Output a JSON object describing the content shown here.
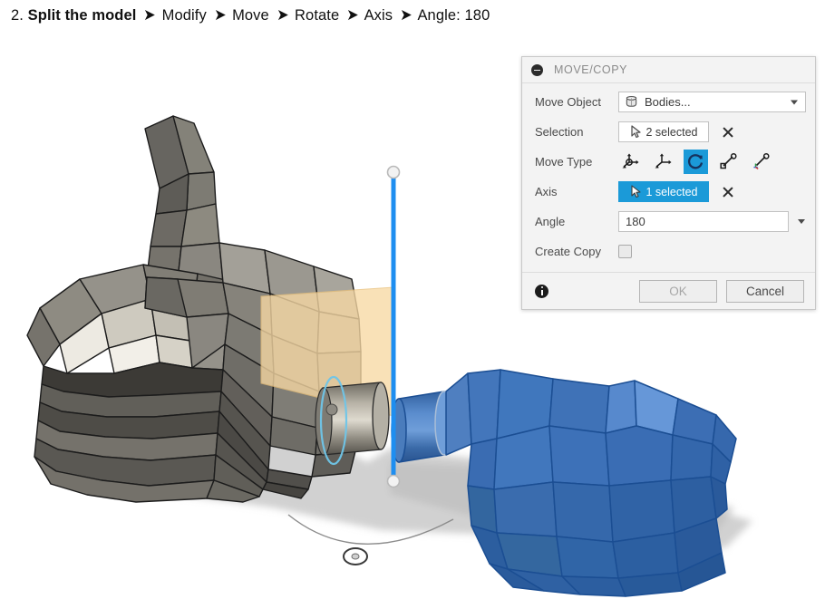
{
  "caption": {
    "step": "2.",
    "bold": "Split the model",
    "arrow_glyph": "➤",
    "items": [
      "Modify",
      "Move",
      "Rotate",
      "Axis",
      "Angle: 180"
    ]
  },
  "dialog": {
    "title": "MOVE/COPY",
    "collapse_icon": "minus-circle-icon",
    "rows": {
      "move_object": {
        "label": "Move Object",
        "value": "Bodies...",
        "icon": "body-cylinder-icon",
        "caret": "chevron-down-icon"
      },
      "selection": {
        "label": "Selection",
        "value": "2 selected",
        "icon": "cursor-arrow-icon",
        "clear": "clear-x-icon"
      },
      "move_type": {
        "label": "Move Type",
        "options": [
          {
            "name": "free-move-icon",
            "label": "Free Move",
            "active": false
          },
          {
            "name": "translate-icon",
            "label": "Translate",
            "active": false
          },
          {
            "name": "rotate-icon",
            "label": "Rotate",
            "active": true
          },
          {
            "name": "point-to-point-icon",
            "label": "Point to Point",
            "active": false
          },
          {
            "name": "point-to-position-icon",
            "label": "Point to Position",
            "active": false
          }
        ]
      },
      "axis": {
        "label": "Axis",
        "value": "1 selected",
        "icon": "cursor-arrow-icon",
        "clear": "clear-x-icon"
      },
      "angle": {
        "label": "Angle",
        "value": "180",
        "caret": "chevron-down-icon"
      },
      "create_copy": {
        "label": "Create Copy",
        "checked": false
      }
    },
    "footer": {
      "info_icon": "info-icon",
      "ok_label": "OK",
      "cancel_label": "Cancel"
    }
  },
  "colors": {
    "accent_blue": "#1b9ad8",
    "selected_body": "#3d6fb4",
    "mesh_grey": "#6f6c64",
    "plane_orange": "#f6d9a8",
    "axis_blue": "#1e8ef0",
    "panel_bg": "#f3f3f3"
  },
  "viewport": {
    "objects": [
      {
        "name": "hand-mesh-body",
        "label": "Thumbs-up mesh body (grey, unselected)"
      },
      {
        "name": "bottle-mesh-body",
        "label": "Faceted body (blue, selected)"
      },
      {
        "name": "construction-plane",
        "label": "Construction plane (orange, translucent)"
      },
      {
        "name": "rotation-axis",
        "label": "Rotation axis line (blue with endpoint handles)"
      },
      {
        "name": "cylinder-peg",
        "label": "Metallic cylinder peg"
      },
      {
        "name": "origin-marker",
        "label": "Origin point marker"
      },
      {
        "name": "ground-shadow",
        "label": "Ground shadow"
      }
    ]
  }
}
